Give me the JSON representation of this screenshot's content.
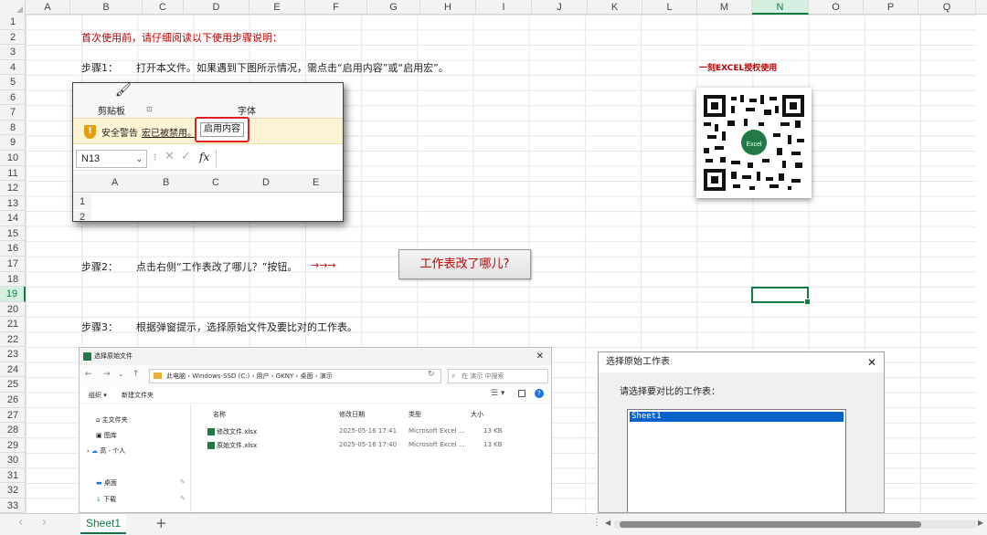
{
  "columns": [
    "A",
    "B",
    "C",
    "D",
    "E",
    "F",
    "G",
    "H",
    "I",
    "J",
    "K",
    "L",
    "M",
    "N",
    "O",
    "P",
    "Q"
  ],
  "selected_column": "N",
  "rows": [
    "1",
    "2",
    "3",
    "4",
    "5",
    "6",
    "7",
    "8",
    "9",
    "10",
    "11",
    "12",
    "13",
    "14",
    "15",
    "16",
    "17",
    "18",
    "19",
    "20",
    "21",
    "22",
    "23",
    "24",
    "25",
    "26",
    "27",
    "28",
    "29",
    "30",
    "31",
    "32",
    "33"
  ],
  "selected_row": "19",
  "sheet": {
    "intro": "首次使用前，请仔细阅读以下使用步骤说明：",
    "step1_label": "步骤1：",
    "step1_text": "打开本文件。如果遇到下图所示情况，需点击“启用内容”或“启用宏”。",
    "step2_label": "步骤2：",
    "step2_text": "点击右侧“工作表改了哪儿？”按钮。",
    "step2_arrows": "→→→",
    "step3_label": "步骤3：",
    "step3_text": "根据弹窗提示，选择原始文件及要比对的工作表。",
    "license_text": "一刻EXCEL授权使用",
    "diff_button": "工作表改了哪儿?"
  },
  "step1_image": {
    "clipboard": "剪贴板",
    "font_group": "字体",
    "security_warning": "安全警告",
    "macros_disabled": "宏已被禁用。",
    "enable_content": "启用内容",
    "name_box": "N13",
    "fx": "fx",
    "cols": [
      "A",
      "B",
      "C",
      "D",
      "E"
    ],
    "rows": [
      "1",
      "2"
    ]
  },
  "qr_center": "Excel",
  "file_dialog": {
    "title": "选择原始文件",
    "path": "此电脑 › Windows-SSD (C:) › 用户 › GKNY › 桌面 › 演示",
    "search_placeholder": "在 演示 中搜索",
    "organize": "组织 ▾",
    "new_folder": "新建文件夹",
    "headers": [
      "名称",
      "修改日期",
      "类型",
      "大小"
    ],
    "files": [
      {
        "name": "修改文件.xlsx",
        "date": "2025-05-16 17:41",
        "type": "Microsoft Excel ...",
        "size": "13 KB"
      },
      {
        "name": "原始文件.xlsx",
        "date": "2025-05-16 17:40",
        "type": "Microsoft Excel ...",
        "size": "13 KB"
      }
    ],
    "sidebar": [
      "主文件夹",
      "图库",
      "高 - 个人",
      "桌面",
      "下载"
    ]
  },
  "compare_dialog": {
    "title": "选择原始工作表",
    "prompt": "请选择要对比的工作表：",
    "items": [
      "Sheet1"
    ]
  },
  "sheet_tab": "Sheet1",
  "add_sheet": "+"
}
